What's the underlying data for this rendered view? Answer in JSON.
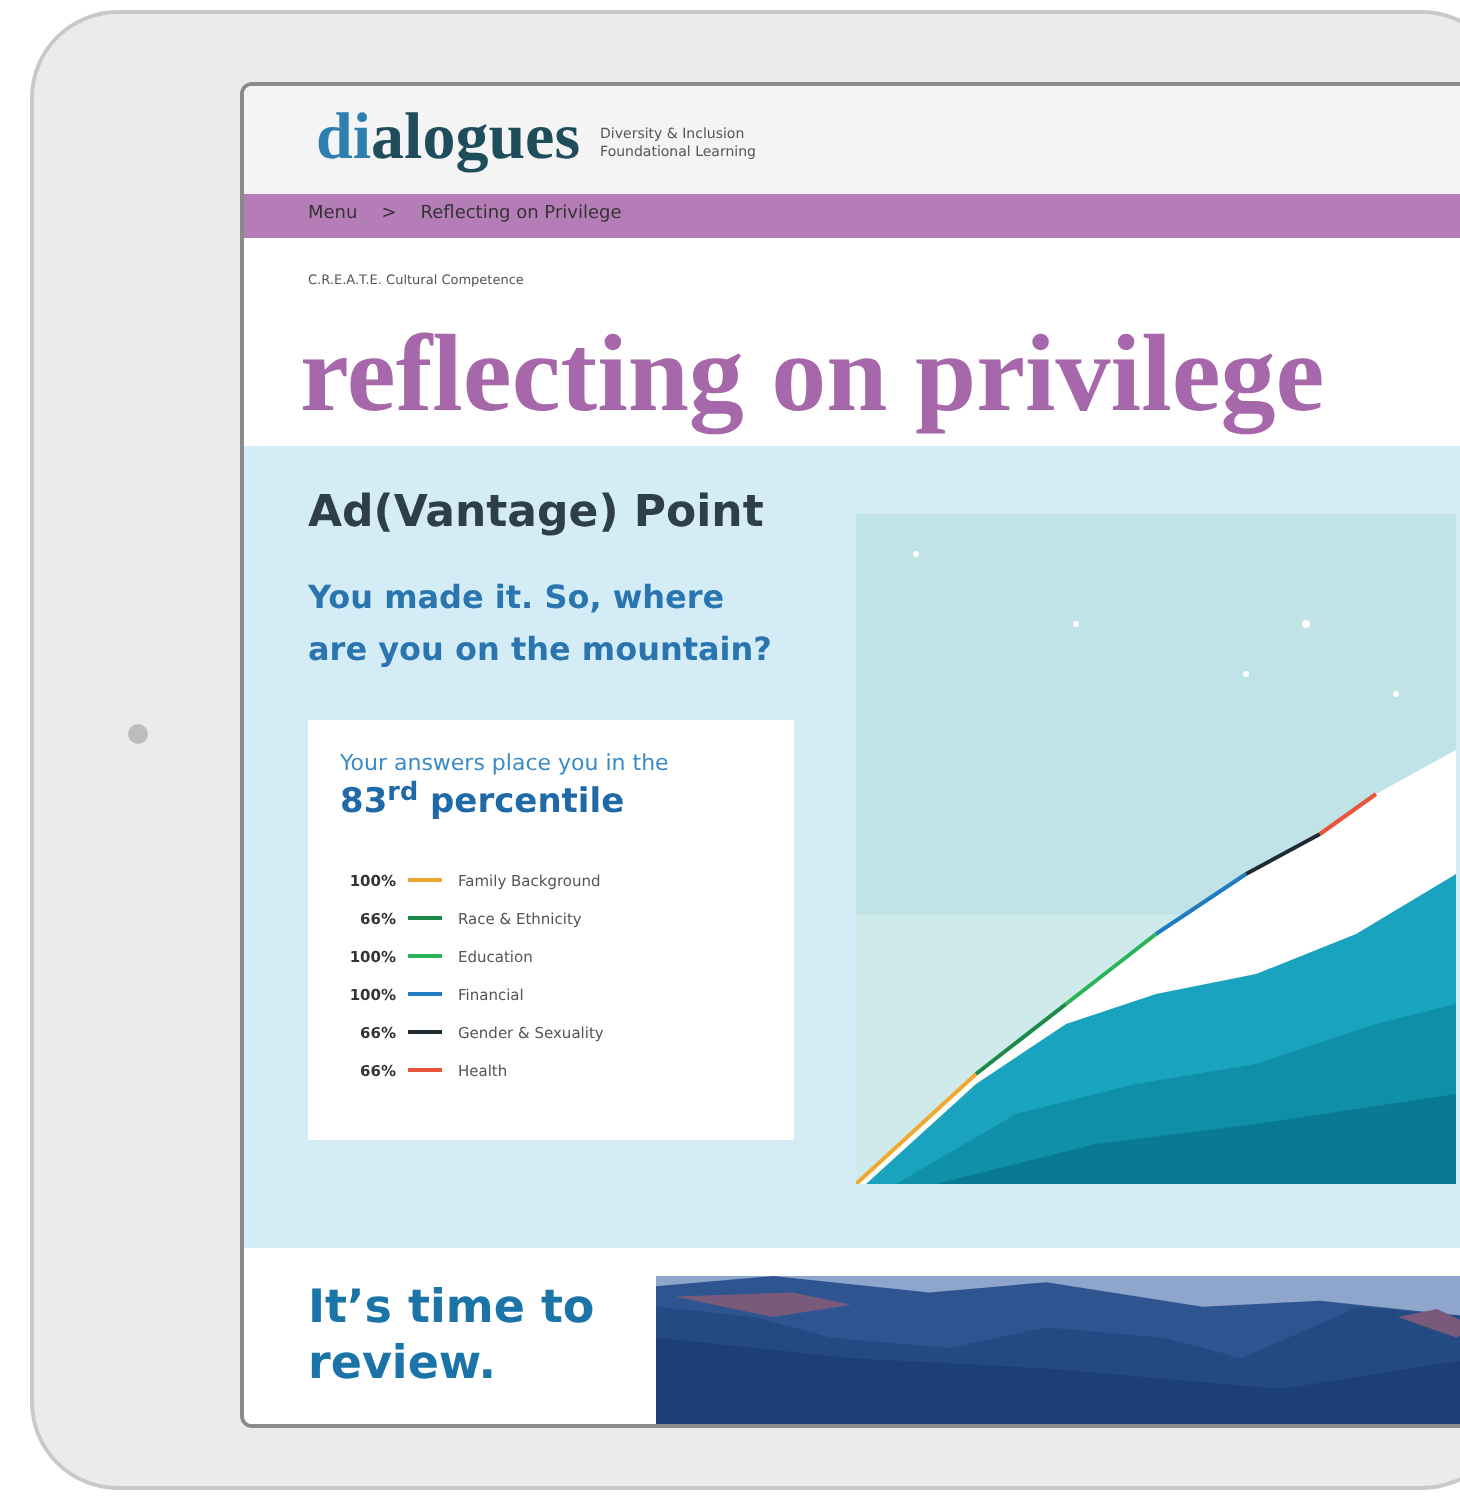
{
  "logo": {
    "accent": "di",
    "rest": "alogues",
    "tagline": [
      "Diversity & Inclusion",
      "Foundational Learning"
    ]
  },
  "breadcrumb": [
    "Menu",
    ">",
    "Reflecting on Privilege"
  ],
  "eyebrow": "C.R.E.A.T.E. Cultural Competence",
  "title": "reflecting on privilege",
  "section": {
    "heading": "Ad(Vantage) Point",
    "question": "You made it. So, where are you on the mountain?",
    "result": {
      "intro": "Your answers place you in the",
      "percentile": "83$^{rd}$ percentile"
    },
    "legend": [
      {
        "percent": "100%",
        "label": "Family Background",
        "color": "#f0a830"
      },
      {
        "percent": "66%",
        "label": "Race & Ethnicity",
        "color": "#1e8a4a"
      },
      {
        "percent": "100%",
        "label": "Education",
        "color": "#2bb35a"
      },
      {
        "percent": "100%",
        "label": "Financial",
        "color": "#1f7cc0"
      },
      {
        "percent": "66%",
        "label": "Gender & Sexuality",
        "color": "#1f2b33"
      },
      {
        "percent": "66%",
        "label": "Health",
        "color": "#e8553a"
      }
    ]
  },
  "review": {
    "heading": "It’s time to review."
  }
}
